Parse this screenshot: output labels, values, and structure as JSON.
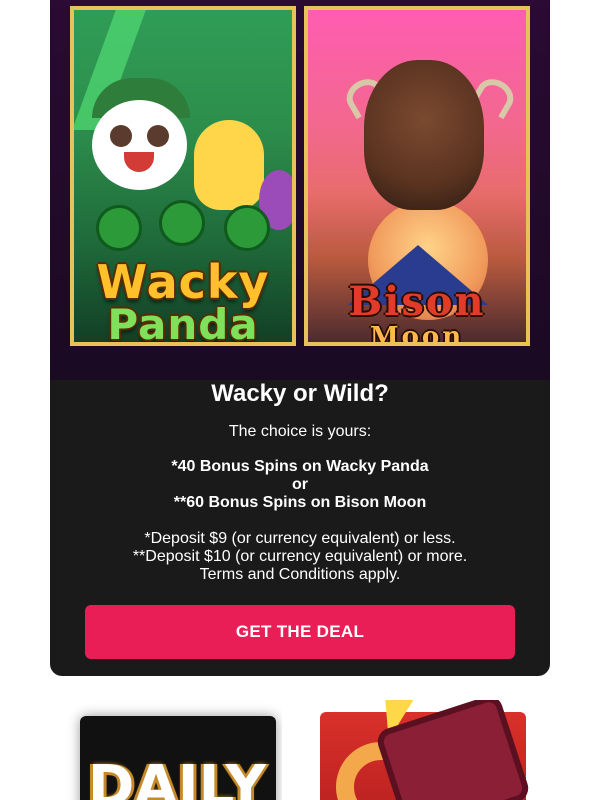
{
  "hero": {
    "left_game_logo": [
      "Wacky",
      "Panda"
    ],
    "right_game_logo": [
      "Bison",
      "Moon"
    ]
  },
  "promo": {
    "headline": "Wacky or Wild?",
    "subheading": "The choice is yours:",
    "offer_line1": "*40 Bonus Spins on Wacky Panda",
    "offer_or": "or",
    "offer_line2": "**60 Bonus Spins on Bison Moon",
    "terms_line1": "*Deposit $9 (or currency equivalent) or less.",
    "terms_line2": "**Deposit $10 (or currency equivalent) or more.",
    "terms_line3": "Terms and Conditions apply.",
    "cta_label": "GET THE DEAL"
  },
  "tiles": {
    "left_logo_text": "DAILY"
  },
  "colors": {
    "card_bg": "#1a1a1a",
    "cta_bg": "#e91e57",
    "text": "#ffffff"
  }
}
